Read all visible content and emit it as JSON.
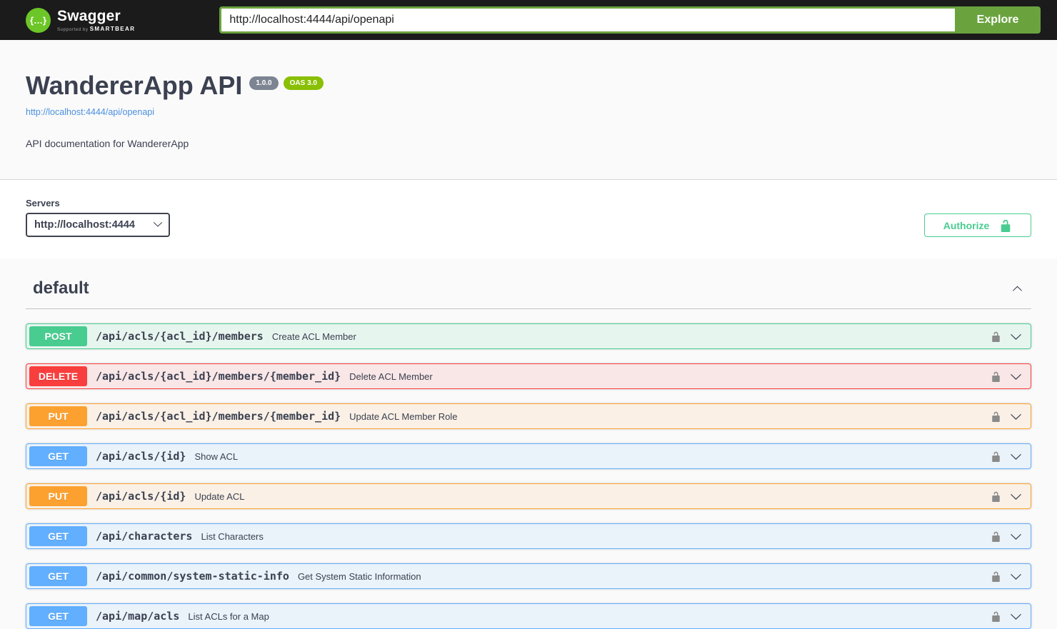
{
  "topbar": {
    "brand": "Swagger",
    "supported_by_prefix": "Supported by",
    "supported_by_brand": "SMARTBEAR",
    "logo_glyph": "{…}",
    "url_value": "http://localhost:4444/api/openapi",
    "explore_label": "Explore"
  },
  "info": {
    "title": "WandererApp API",
    "version_badge": "1.0.0",
    "oas_badge": "OAS 3.0",
    "spec_link": "http://localhost:4444/api/openapi",
    "description": "API documentation for WandererApp"
  },
  "servers": {
    "label": "Servers",
    "selected": "http://localhost:4444"
  },
  "auth": {
    "authorize_label": "Authorize"
  },
  "section": {
    "title": "default"
  },
  "icons": {
    "topbar_logo": "swagger-logo-icon",
    "authorize_lock": "unlock-icon",
    "row_lock": "unlock-icon",
    "row_expand": "chevron-down-icon",
    "section_collapse": "chevron-up-icon",
    "server_select": "chevron-down-icon"
  },
  "colors": {
    "topbar_bg": "#1b1b1b",
    "logo_green": "#6cc628",
    "explore_green": "#6aa33e",
    "authorize_green": "#49cc90",
    "link_blue": "#4990e2",
    "version_badge_bg": "#7d8492",
    "oas_badge_bg": "#89bf04",
    "get": "#61affe",
    "post": "#49cc90",
    "put": "#fca130",
    "delete": "#f93e3e",
    "text": "#3b4151",
    "page_bg": "#fafafa"
  },
  "endpoints": [
    {
      "method": "POST",
      "path": "/api/acls/{acl_id}/members",
      "summary": "Create ACL Member"
    },
    {
      "method": "DELETE",
      "path": "/api/acls/{acl_id}/members/{member_id}",
      "summary": "Delete ACL Member"
    },
    {
      "method": "PUT",
      "path": "/api/acls/{acl_id}/members/{member_id}",
      "summary": "Update ACL Member Role"
    },
    {
      "method": "GET",
      "path": "/api/acls/{id}",
      "summary": "Show ACL"
    },
    {
      "method": "PUT",
      "path": "/api/acls/{id}",
      "summary": "Update ACL"
    },
    {
      "method": "GET",
      "path": "/api/characters",
      "summary": "List Characters"
    },
    {
      "method": "GET",
      "path": "/api/common/system-static-info",
      "summary": "Get System Static Information"
    },
    {
      "method": "GET",
      "path": "/api/map/acls",
      "summary": "List ACLs for a Map"
    }
  ]
}
